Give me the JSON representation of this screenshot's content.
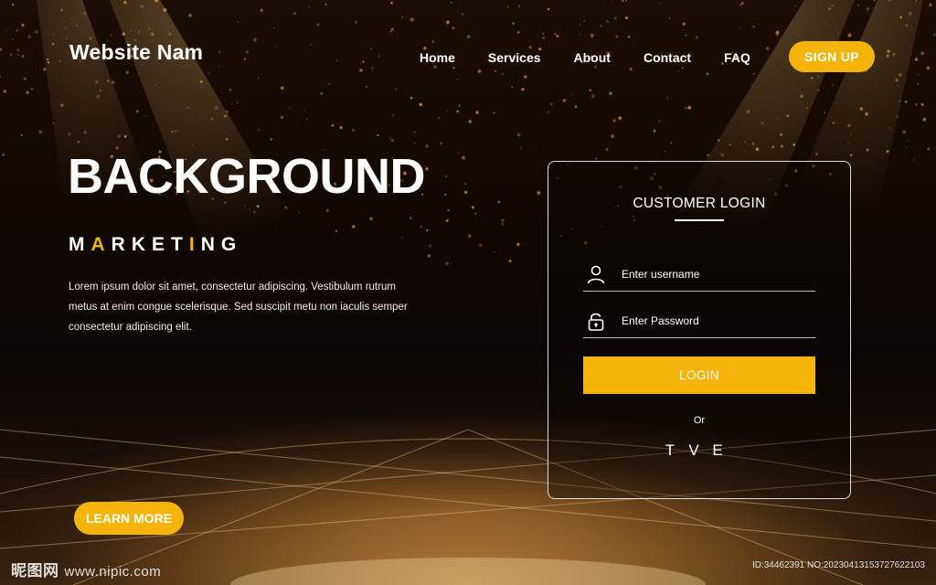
{
  "nav": {
    "brand": "Website Nam",
    "links": [
      "Home",
      "Services",
      "About",
      "Contact",
      "FAQ"
    ],
    "signup_label": "SIGN UP"
  },
  "hero": {
    "title": "BACKGROUND",
    "subtitle_parts": [
      "M",
      "A",
      "RKET",
      "I",
      "NG"
    ],
    "body": "Lorem ipsum dolor sit amet, consectetur adipiscing. Vestibulum rutrum metus at enim congue scelerisque. Sed suscipit metu non iaculis semper consectetur adipiscing elit.",
    "learn_more_label": "LEARN MORE"
  },
  "login": {
    "title": "CUSTOMER LOGIN",
    "username_placeholder": "Enter username",
    "password_placeholder": "Enter Password",
    "login_label": "LOGIN",
    "or_label": "Or",
    "social": [
      {
        "glyph": "T",
        "icon": "twitter-icon"
      },
      {
        "glyph": "V",
        "icon": "vimeo-icon"
      },
      {
        "glyph": "E",
        "icon": "email-icon"
      }
    ]
  },
  "watermark": {
    "left_brand": "昵图网",
    "left_site": "www.nipic.com",
    "right_id": "ID:34462391 NO:20230413153727622103"
  },
  "colors": {
    "accent": "#f5b40a",
    "background_dark": "#120904",
    "text": "#ffffff"
  }
}
